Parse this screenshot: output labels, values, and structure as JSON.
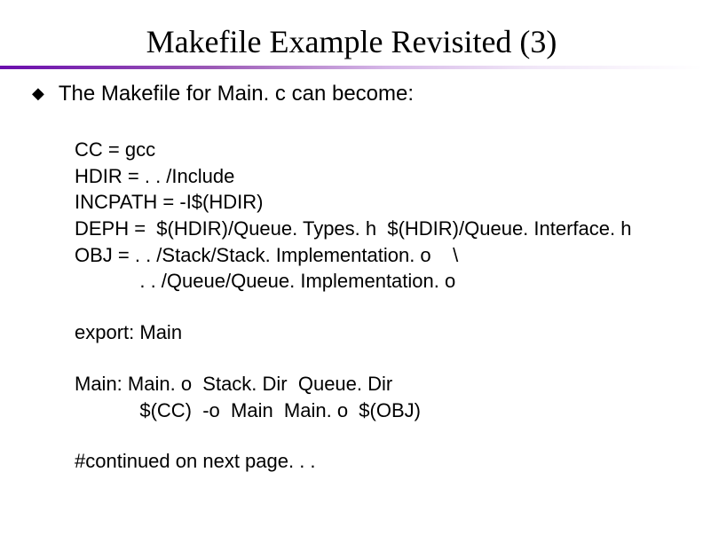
{
  "title": "Makefile Example Revisited (3)",
  "bullet": {
    "text": "The Makefile for Main. c can become:"
  },
  "code": {
    "l1": "CC = gcc",
    "l2": "HDIR = . . /Include",
    "l3": "INCPATH = -I$(HDIR)",
    "l4": "DEPH =  $(HDIR)/Queue. Types. h  $(HDIR)/Queue. Interface. h",
    "l5": "OBJ = . . /Stack/Stack. Implementation. o    \\",
    "l6": "            . . /Queue/Queue. Implementation. o",
    "l7": "export: Main",
    "l8": "Main: Main. o  Stack. Dir  Queue. Dir",
    "l9": "            $(CC)  -o  Main  Main. o  $(OBJ)",
    "l10": "#continued on next page. . ."
  }
}
